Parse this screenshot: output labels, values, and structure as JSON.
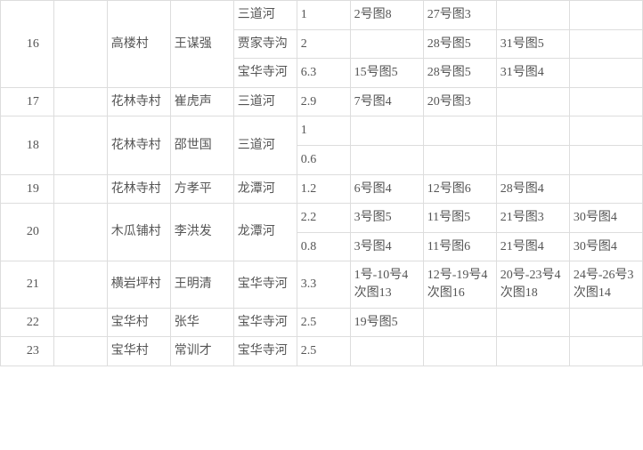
{
  "rows": [
    {
      "id": "16",
      "id_rs": 3,
      "c1": "",
      "c1_rs": 3,
      "c2": "高楼村",
      "c2_rs": 3,
      "c3": "王谋强",
      "c3_rs": 3,
      "c4": "三道河",
      "c5": "1",
      "c6": "2号图8",
      "c7": "27号图3",
      "c8": "",
      "c9": ""
    },
    {
      "c4": "贾家寺沟",
      "c5": "2",
      "c6": "",
      "c7": "28号图5",
      "c8": "31号图5",
      "c9": ""
    },
    {
      "c4": "宝华寺河",
      "c5": "6.3",
      "c6": "15号图5",
      "c7": "28号图5",
      "c8": "31号图4",
      "c9": ""
    },
    {
      "id": "17",
      "c1": "",
      "c2": "花林寺村",
      "c3": "崔虎声",
      "c4": "三道河",
      "c5": "2.9",
      "c6": "7号图4",
      "c7": "20号图3",
      "c8": "",
      "c9": ""
    },
    {
      "id": "18",
      "id_rs": 2,
      "c1": "",
      "c1_rs": 2,
      "c2": "花林寺村",
      "c2_rs": 2,
      "c3": "邵世国",
      "c3_rs": 2,
      "c4": "三道河",
      "c4_rs": 2,
      "c5": "1",
      "c6": "",
      "c7": "",
      "c8": "",
      "c9": ""
    },
    {
      "c5": "0.6",
      "c6": "",
      "c7": "",
      "c8": "",
      "c9": ""
    },
    {
      "id": "19",
      "c1": "",
      "c2": "花林寺村",
      "c3": "方孝平",
      "c4": "龙潭河",
      "c5": "1.2",
      "c6": "6号图4",
      "c7": "12号图6",
      "c8": "28号图4",
      "c9": ""
    },
    {
      "id": "20",
      "id_rs": 2,
      "c1": "",
      "c1_rs": 2,
      "c2": "木瓜铺村",
      "c2_rs": 2,
      "c3": "李洪发",
      "c3_rs": 2,
      "c4": "龙潭河",
      "c4_rs": 2,
      "c5": "2.2",
      "c6": "3号图5",
      "c7": "11号图5",
      "c8": "21号图3",
      "c9": "30号图4"
    },
    {
      "c5": "0.8",
      "c6": "3号图4",
      "c7": "11号图6",
      "c8": "21号图4",
      "c9": "30号图4"
    },
    {
      "id": "21",
      "c1": "",
      "c2": "横岩坪村",
      "c3": "王明清",
      "c4": "宝华寺河",
      "c5": "3.3",
      "c6": "1号-10号4次图13",
      "c7": "12号-19号4次图16",
      "c8": "20号-23号4次图18",
      "c9": "24号-26号3次图14"
    },
    {
      "id": "22",
      "c1": "",
      "c2": "宝华村",
      "c3": "张华",
      "c4": "宝华寺河",
      "c5": "2.5",
      "c6": "19号图5",
      "c7": "",
      "c8": "",
      "c9": ""
    },
    {
      "id": "23",
      "c1": "",
      "c2": "宝华村",
      "c3": "常训才",
      "c4": "宝华寺河",
      "c5": "2.5",
      "c6": "",
      "c7": "",
      "c8": "",
      "c9": ""
    }
  ],
  "chart_data": {
    "type": "table",
    "rows": [
      {
        "num": 16,
        "village": "高楼村",
        "person": "王谋强",
        "river": "三道河",
        "value": 1,
        "f1": "2号图8",
        "f2": "27号图3",
        "f3": "",
        "f4": ""
      },
      {
        "num": 16,
        "village": "高楼村",
        "person": "王谋强",
        "river": "贾家寺沟",
        "value": 2,
        "f1": "",
        "f2": "28号图5",
        "f3": "31号图5",
        "f4": ""
      },
      {
        "num": 16,
        "village": "高楼村",
        "person": "王谋强",
        "river": "宝华寺河",
        "value": 6.3,
        "f1": "15号图5",
        "f2": "28号图5",
        "f3": "31号图4",
        "f4": ""
      },
      {
        "num": 17,
        "village": "花林寺村",
        "person": "崔虎声",
        "river": "三道河",
        "value": 2.9,
        "f1": "7号图4",
        "f2": "20号图3",
        "f3": "",
        "f4": ""
      },
      {
        "num": 18,
        "village": "花林寺村",
        "person": "邵世国",
        "river": "三道河",
        "value": 1,
        "f1": "",
        "f2": "",
        "f3": "",
        "f4": ""
      },
      {
        "num": 18,
        "village": "花林寺村",
        "person": "邵世国",
        "river": "三道河",
        "value": 0.6,
        "f1": "",
        "f2": "",
        "f3": "",
        "f4": ""
      },
      {
        "num": 19,
        "village": "花林寺村",
        "person": "方孝平",
        "river": "龙潭河",
        "value": 1.2,
        "f1": "6号图4",
        "f2": "12号图6",
        "f3": "28号图4",
        "f4": ""
      },
      {
        "num": 20,
        "village": "木瓜铺村",
        "person": "李洪发",
        "river": "龙潭河",
        "value": 2.2,
        "f1": "3号图5",
        "f2": "11号图5",
        "f3": "21号图3",
        "f4": "30号图4"
      },
      {
        "num": 20,
        "village": "木瓜铺村",
        "person": "李洪发",
        "river": "龙潭河",
        "value": 0.8,
        "f1": "3号图4",
        "f2": "11号图6",
        "f3": "21号图4",
        "f4": "30号图4"
      },
      {
        "num": 21,
        "village": "横岩坪村",
        "person": "王明清",
        "river": "宝华寺河",
        "value": 3.3,
        "f1": "1号-10号4次图13",
        "f2": "12号-19号4次图16",
        "f3": "20号-23号4次图18",
        "f4": "24号-26号3次图14"
      },
      {
        "num": 22,
        "village": "宝华村",
        "person": "张华",
        "river": "宝华寺河",
        "value": 2.5,
        "f1": "19号图5",
        "f2": "",
        "f3": "",
        "f4": ""
      },
      {
        "num": 23,
        "village": "宝华村",
        "person": "常训才",
        "river": "宝华寺河",
        "value": 2.5,
        "f1": "",
        "f2": "",
        "f3": "",
        "f4": ""
      }
    ]
  }
}
